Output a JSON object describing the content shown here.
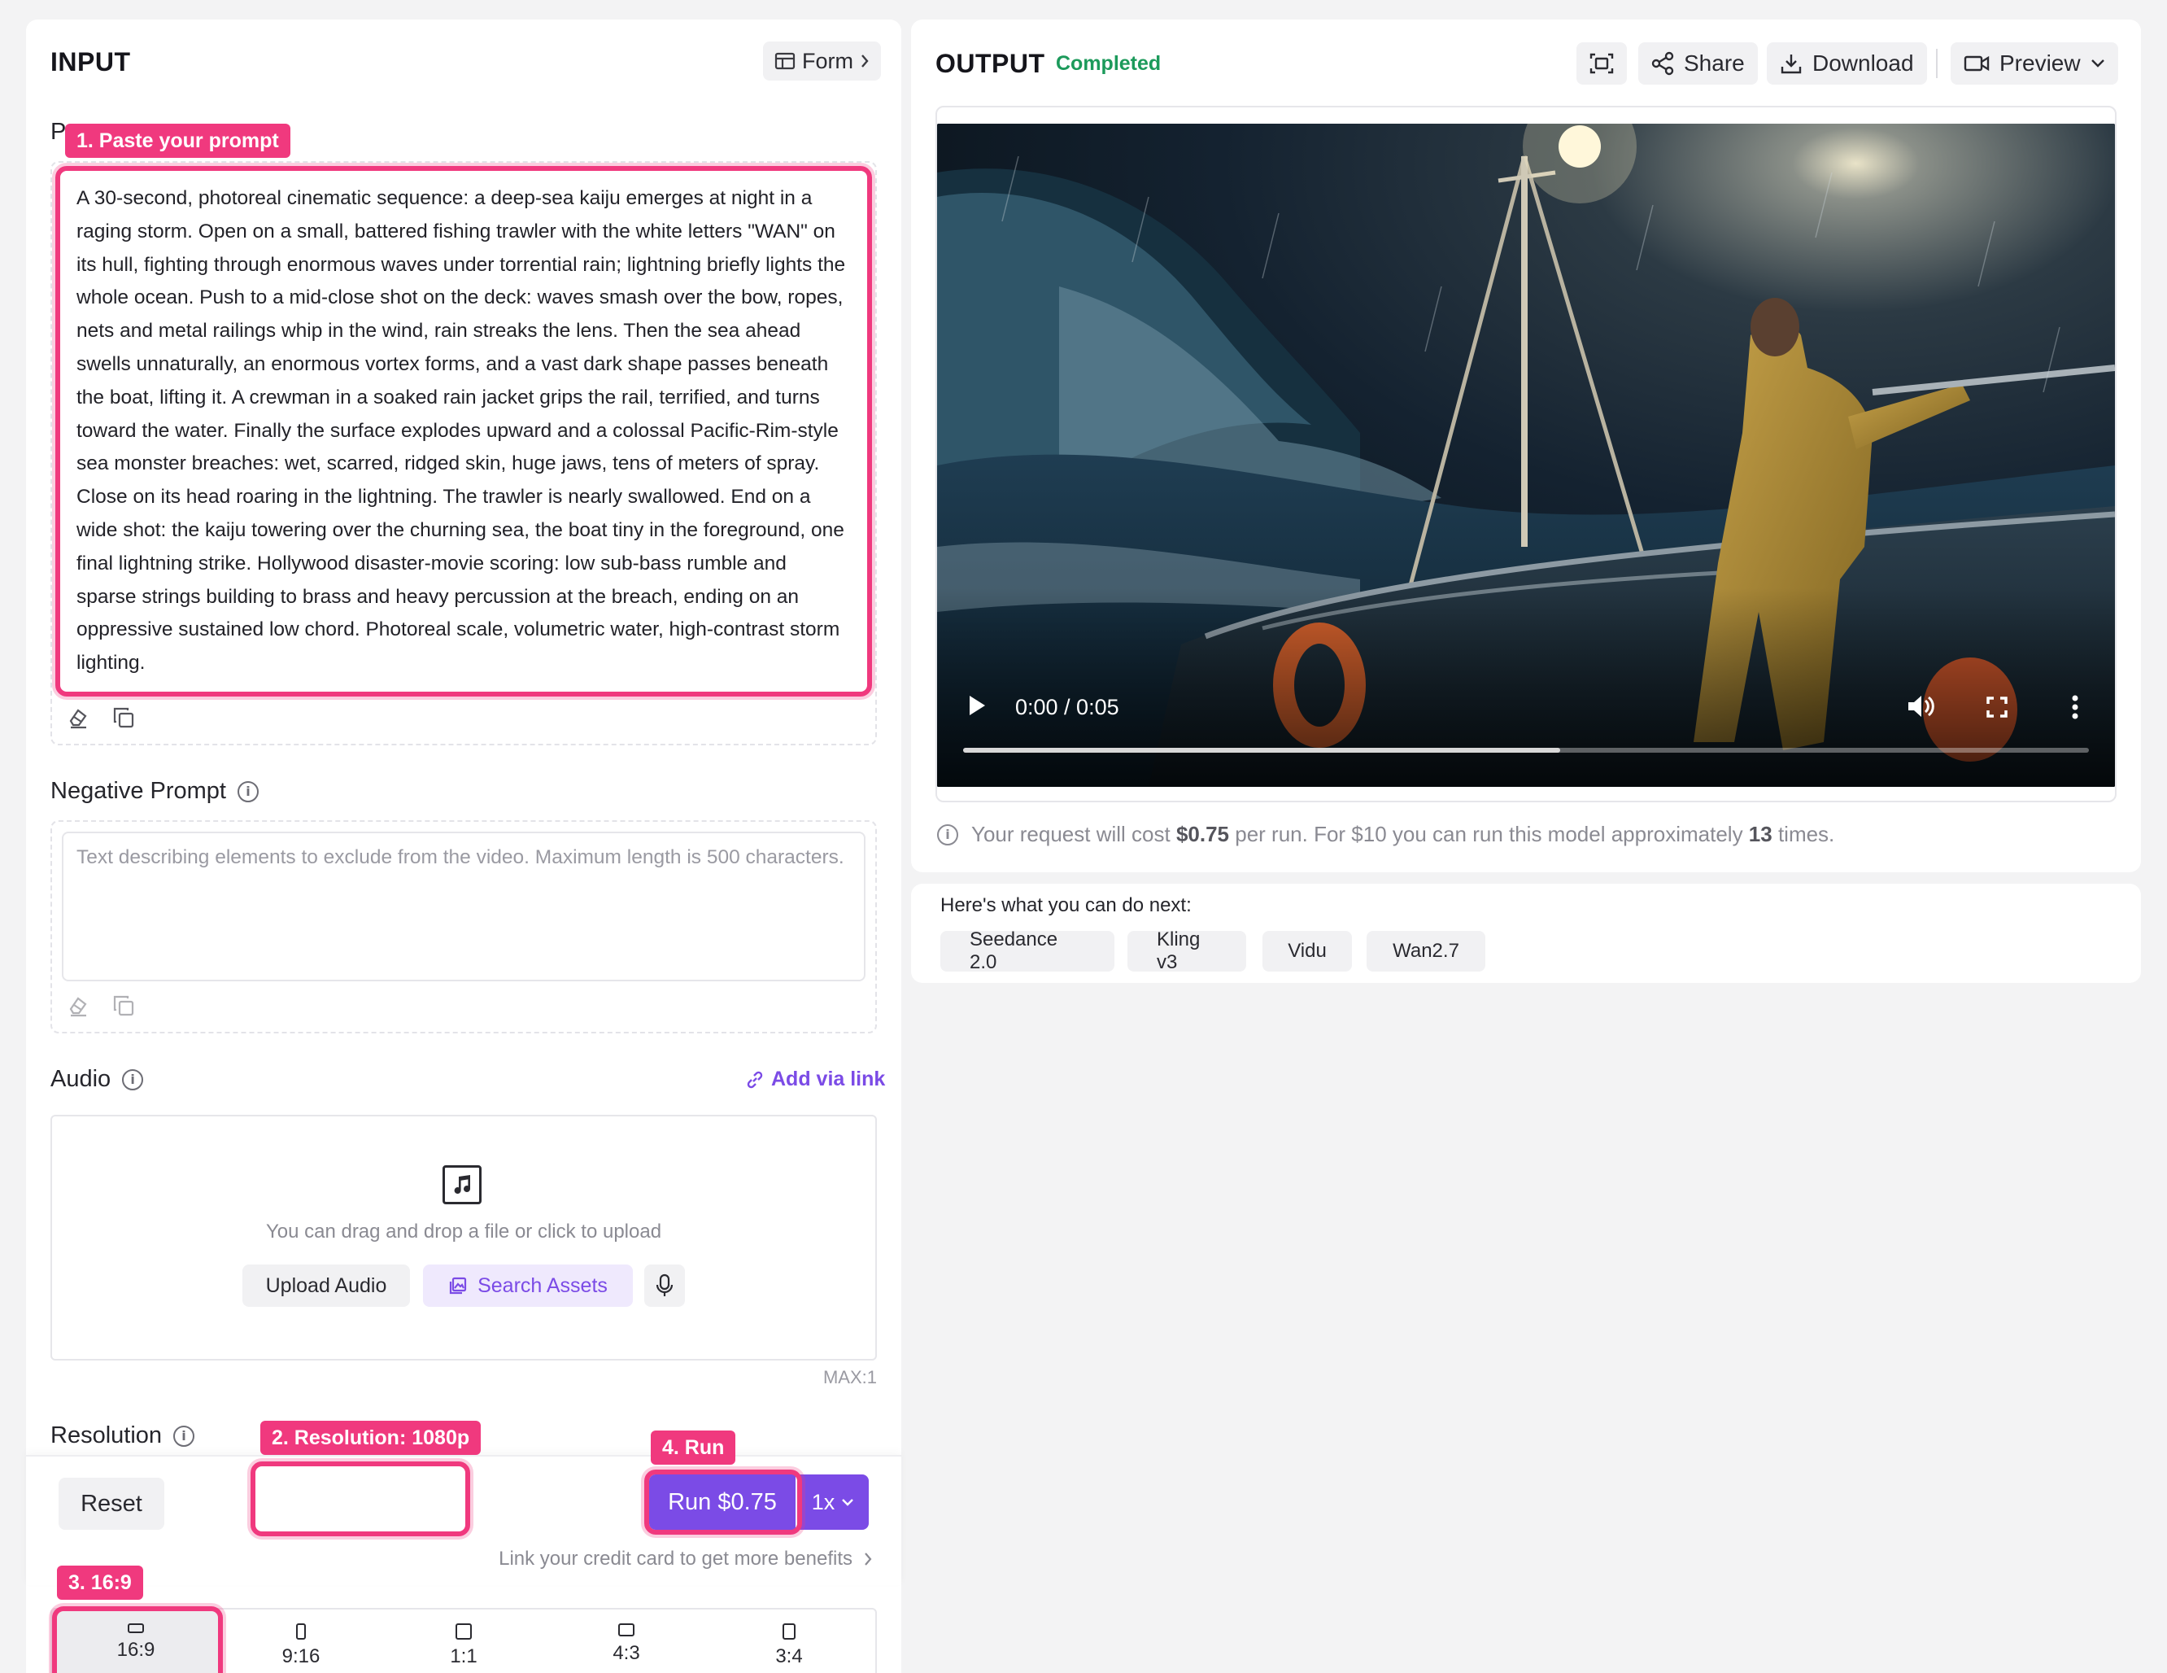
{
  "input": {
    "title": "INPUT",
    "form_label": "Form",
    "prompt_label_partial": "P",
    "prompt_text": "A 30-second, photoreal cinematic sequence: a deep-sea kaiju emerges at night in a raging storm. Open on a small, battered fishing trawler with the white letters \"WAN\" on its hull, fighting through enormous waves under torrential rain; lightning briefly lights the whole ocean. Push to a mid-close shot on the deck: waves smash over the bow, ropes, nets and metal railings whip in the wind, rain streaks the lens. Then the sea ahead swells unnaturally, an enormous vortex forms, and a vast dark shape passes beneath the boat, lifting it. A crewman in a soaked rain jacket grips the rail, terrified, and turns toward the water. Finally the surface explodes upward and a colossal Pacific-Rim-style sea monster breaches: wet, scarred, ridged skin, huge jaws, tens of meters of spray. Close on its head roaring in the lightning. The trawler is nearly swallowed. End on a wide shot: the kaiju towering over the churning sea, the boat tiny in the foreground, one final lightning strike. Hollywood disaster-movie scoring: low sub-bass rumble and sparse strings building to brass and heavy percussion at the breach, ending on an oppressive sustained low chord. Photoreal scale, volumetric water, high-contrast storm lighting.",
    "negative_label": "Negative Prompt",
    "negative_placeholder": "Text describing elements to exclude from the video. Maximum length is 500 characters.",
    "audio_label": "Audio",
    "add_via_link": "Add via link",
    "upload_hint": "You can drag and drop a file or click to upload",
    "upload_audio": "Upload Audio",
    "search_assets": "Search Assets",
    "max_label": "MAX:1",
    "resolution_label": "Resolution",
    "reset_label": "Reset",
    "run_label": "Run $0.75",
    "run_multiplier": "1x",
    "credit_link": "Link your credit card to get more benefits",
    "ratios": [
      "16:9",
      "9:16",
      "1:1",
      "4:3",
      "3:4"
    ]
  },
  "annotations": {
    "step1": "1. Paste your prompt",
    "step2": "2. Resolution: 1080p",
    "step3": "3. 16:9",
    "step4": "4. Run"
  },
  "output": {
    "title": "OUTPUT",
    "status": "Completed",
    "share": "Share",
    "download": "Download",
    "preview": "Preview",
    "time_display": "0:00 / 0:05",
    "progress": 0.53,
    "cost_prefix": "Your request will cost ",
    "cost_value": "$0.75",
    "cost_middle": " per run. For $10 you can run this model approximately ",
    "cost_runs": "13",
    "cost_suffix": " times.",
    "next_label": "Here's what you can do next:",
    "next_options": [
      "Seedance 2.0",
      "Kling v3",
      "Vidu",
      "Wan2.7"
    ]
  },
  "colors": {
    "accent": "#7b4be6",
    "annotation": "#f0397e",
    "status_green": "#1c9a5b"
  }
}
